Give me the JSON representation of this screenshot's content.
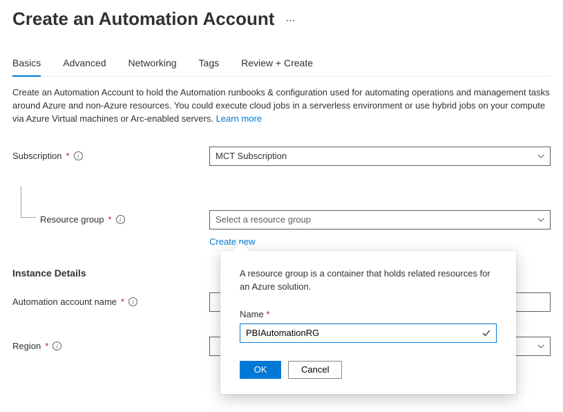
{
  "header": {
    "title": "Create an Automation Account"
  },
  "tabs": {
    "basics": "Basics",
    "advanced": "Advanced",
    "networking": "Networking",
    "tags": "Tags",
    "review": "Review + Create"
  },
  "description": {
    "text": "Create an Automation Account to hold the Automation runbooks & configuration used for automating operations and management tasks around Azure and non-Azure resources. You could execute cloud jobs in a serverless environment or use hybrid jobs on your compute via Azure Virtual machines or Arc-enabled servers. ",
    "learn_more": "Learn more"
  },
  "form": {
    "subscription": {
      "label": "Subscription",
      "value": "MCT Subscription"
    },
    "resource_group": {
      "label": "Resource group",
      "placeholder": "Select a resource group",
      "create_new": "Create new"
    },
    "section_title": "Instance Details",
    "automation_name": {
      "label": "Automation account name"
    },
    "region": {
      "label": "Region"
    }
  },
  "popover": {
    "description": "A resource group is a container that holds related resources for an Azure solution.",
    "name_label": "Name",
    "name_value": "PBIAutomationRG",
    "ok": "OK",
    "cancel": "Cancel"
  }
}
